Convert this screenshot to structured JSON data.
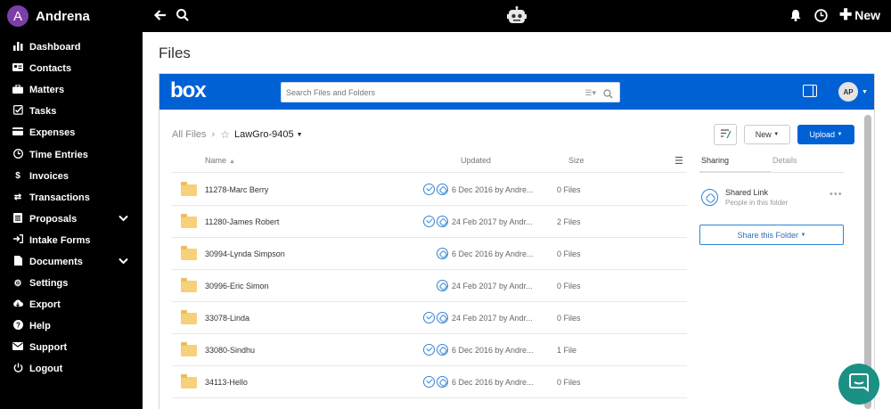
{
  "app": {
    "user_name": "Andrena",
    "user_initial": "A"
  },
  "sidebar": {
    "items": [
      {
        "label": "Dashboard",
        "icon": "bar-chart-icon"
      },
      {
        "label": "Contacts",
        "icon": "contact-card-icon"
      },
      {
        "label": "Matters",
        "icon": "briefcase-icon"
      },
      {
        "label": "Tasks",
        "icon": "checkbox-icon"
      },
      {
        "label": "Expenses",
        "icon": "credit-card-icon"
      },
      {
        "label": "Time Entries",
        "icon": "clock-icon"
      },
      {
        "label": "Invoices",
        "icon": "dollar-icon"
      },
      {
        "label": "Transactions",
        "icon": "exchange-icon"
      },
      {
        "label": "Proposals",
        "icon": "document-list-icon",
        "expandable": true
      },
      {
        "label": "Intake Forms",
        "icon": "sign-in-icon"
      },
      {
        "label": "Documents",
        "icon": "file-icon",
        "expandable": true
      },
      {
        "label": "Settings",
        "icon": "gear-icon"
      },
      {
        "label": "Export",
        "icon": "cloud-download-icon"
      },
      {
        "label": "Help",
        "icon": "help-icon"
      },
      {
        "label": "Support",
        "icon": "envelope-icon"
      },
      {
        "label": "Logout",
        "icon": "power-icon"
      }
    ]
  },
  "topbar": {
    "new_label": "New"
  },
  "page": {
    "title": "Files"
  },
  "box": {
    "logo": "box",
    "search_placeholder": "Search Files and Folders",
    "user_initials": "AP",
    "breadcrumb": {
      "root": "All Files",
      "current": "LawGro-9405"
    },
    "actions": {
      "new_label": "New",
      "upload_label": "Upload"
    },
    "columns": {
      "name": "Name",
      "updated": "Updated",
      "size": "Size"
    },
    "rows": [
      {
        "name": "11278-Marc Berry",
        "updated": "6 Dec 2016 by Andre...",
        "size": "0 Files",
        "shared": true,
        "linked": true
      },
      {
        "name": "11280-James Robert",
        "updated": "24 Feb 2017 by Andr...",
        "size": "2 Files",
        "shared": true,
        "linked": true
      },
      {
        "name": "30994-Lynda Simpson",
        "updated": "6 Dec 2016 by Andre...",
        "size": "0 Files",
        "shared": false,
        "linked": true
      },
      {
        "name": "30996-Eric Simon",
        "updated": "24 Feb 2017 by Andr...",
        "size": "0 Files",
        "shared": false,
        "linked": true
      },
      {
        "name": "33078-Linda",
        "updated": "24 Feb 2017 by Andr...",
        "size": "0 Files",
        "shared": true,
        "linked": true
      },
      {
        "name": "33080-Sindhu",
        "updated": "6 Dec 2016 by Andre...",
        "size": "1 File",
        "shared": true,
        "linked": true
      },
      {
        "name": "34113-Hello",
        "updated": "6 Dec 2016 by Andre...",
        "size": "0 Files",
        "shared": true,
        "linked": true
      }
    ],
    "sidebar": {
      "tab_sharing": "Sharing",
      "tab_details": "Details",
      "shared_link_title": "Shared Link",
      "shared_link_sub": "People in this folder",
      "share_folder_label": "Share this Folder"
    }
  },
  "colors": {
    "box_blue": "#0061d5",
    "sidebar_bg": "#000000",
    "avatar_purple": "#7b3fa6",
    "chat_teal": "#1a9184",
    "folder_yellow": "#f5d27a"
  }
}
